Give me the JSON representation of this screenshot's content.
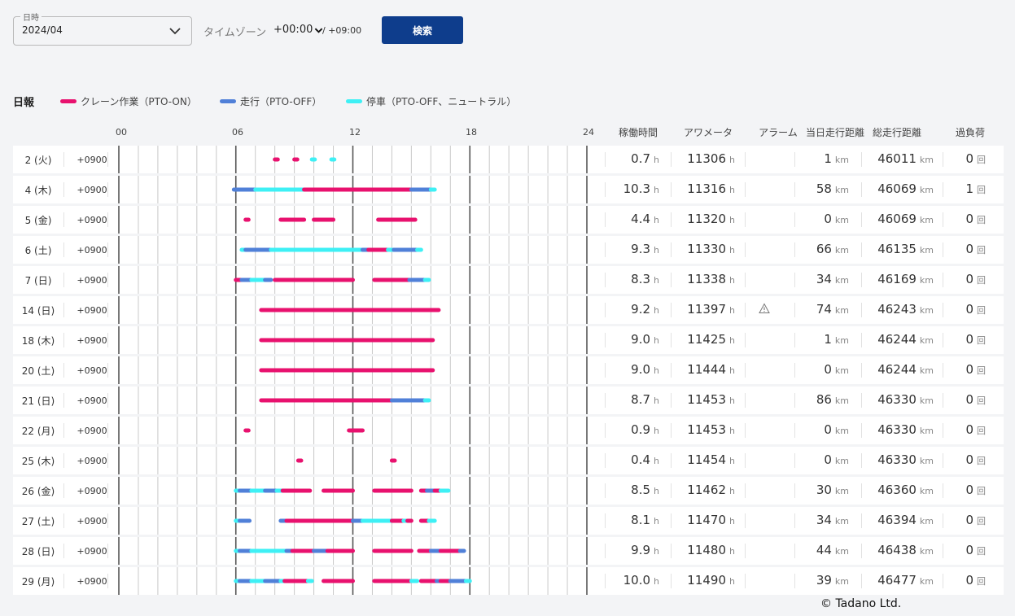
{
  "filters": {
    "date_label": "日時",
    "date_value": "2024/04",
    "timezone_label": "タイムゾーン",
    "timezone_value": "+00:00",
    "timezone_offset": "/ +09:00",
    "search_label": "検索"
  },
  "legend": {
    "title": "日報",
    "items": [
      {
        "label": "クレーン作業（PTO-ON）",
        "color": "#e8116e"
      },
      {
        "label": "走行（PTO-OFF）",
        "color": "#5080d8"
      },
      {
        "label": "停車（PTO-OFF、ニュートラル）",
        "color": "#3ef0f5"
      }
    ]
  },
  "hour_labels": [
    "00",
    "06",
    "12",
    "18",
    "24"
  ],
  "columns": {
    "operating": "稼働時間",
    "hourmeter": "アワメータ",
    "alarm": "アラーム",
    "daily_distance": "当日走行距離",
    "total_distance": "総走行距離",
    "overload": "過負荷"
  },
  "units": {
    "hours": "h",
    "km": "km",
    "count": "回"
  },
  "rows": [
    {
      "day": "2 (火)",
      "tz": "+0900",
      "operating": "0.7",
      "hourmeter": "11306",
      "alarm": false,
      "daily_km": "1",
      "total_km": "46011",
      "overload": "0",
      "segments": [
        [
          8.0,
          8.15,
          "c"
        ],
        [
          9.0,
          9.15,
          "c"
        ],
        [
          9.9,
          10.05,
          "s"
        ],
        [
          10.9,
          11.05,
          "s"
        ]
      ]
    },
    {
      "day": "4 (木)",
      "tz": "+0900",
      "operating": "10.3",
      "hourmeter": "11316",
      "alarm": false,
      "daily_km": "58",
      "total_km": "46069",
      "overload": "1",
      "segments": [
        [
          5.9,
          7.0,
          "d"
        ],
        [
          7.0,
          9.5,
          "s"
        ],
        [
          9.5,
          15.0,
          "c"
        ],
        [
          15.0,
          16.0,
          "d"
        ],
        [
          16.0,
          16.2,
          "s"
        ]
      ]
    },
    {
      "day": "5 (金)",
      "tz": "+0900",
      "operating": "4.4",
      "hourmeter": "11320",
      "alarm": false,
      "daily_km": "0",
      "total_km": "46069",
      "overload": "0",
      "segments": [
        [
          6.5,
          6.65,
          "c"
        ],
        [
          8.3,
          9.5,
          "c"
        ],
        [
          10.0,
          11.0,
          "c"
        ],
        [
          13.3,
          15.2,
          "c"
        ]
      ]
    },
    {
      "day": "6 (土)",
      "tz": "+0900",
      "operating": "9.3",
      "hourmeter": "11330",
      "alarm": false,
      "daily_km": "66",
      "total_km": "46135",
      "overload": "0",
      "segments": [
        [
          6.3,
          6.5,
          "s"
        ],
        [
          6.5,
          7.8,
          "d"
        ],
        [
          7.8,
          12.5,
          "s"
        ],
        [
          12.5,
          12.8,
          "d"
        ],
        [
          12.8,
          13.8,
          "c"
        ],
        [
          13.8,
          14.1,
          "s"
        ],
        [
          14.1,
          15.3,
          "d"
        ],
        [
          15.3,
          15.5,
          "s"
        ]
      ]
    },
    {
      "day": "7 (日)",
      "tz": "+0900",
      "operating": "8.3",
      "hourmeter": "11338",
      "alarm": false,
      "daily_km": "34",
      "total_km": "46169",
      "overload": "0",
      "segments": [
        [
          6.0,
          6.3,
          "c"
        ],
        [
          6.3,
          6.8,
          "d"
        ],
        [
          6.8,
          7.5,
          "s"
        ],
        [
          7.5,
          7.8,
          "d"
        ],
        [
          8.0,
          12.0,
          "c"
        ],
        [
          13.1,
          14.9,
          "c"
        ],
        [
          14.9,
          15.7,
          "d"
        ],
        [
          15.7,
          15.9,
          "s"
        ]
      ]
    },
    {
      "day": "14 (日)",
      "tz": "+0900",
      "operating": "9.2",
      "hourmeter": "11397",
      "alarm": true,
      "daily_km": "74",
      "total_km": "46243",
      "overload": "0",
      "segments": [
        [
          7.3,
          16.4,
          "c"
        ]
      ]
    },
    {
      "day": "18 (木)",
      "tz": "+0900",
      "operating": "9.0",
      "hourmeter": "11425",
      "alarm": false,
      "daily_km": "1",
      "total_km": "46244",
      "overload": "0",
      "segments": [
        [
          7.3,
          16.1,
          "c"
        ]
      ]
    },
    {
      "day": "20 (土)",
      "tz": "+0900",
      "operating": "9.0",
      "hourmeter": "11444",
      "alarm": false,
      "daily_km": "0",
      "total_km": "46244",
      "overload": "0",
      "segments": [
        [
          7.3,
          16.1,
          "c"
        ]
      ]
    },
    {
      "day": "21 (日)",
      "tz": "+0900",
      "operating": "8.7",
      "hourmeter": "11453",
      "alarm": false,
      "daily_km": "86",
      "total_km": "46330",
      "overload": "0",
      "segments": [
        [
          7.3,
          14.0,
          "c"
        ],
        [
          14.0,
          15.7,
          "d"
        ],
        [
          15.7,
          15.9,
          "s"
        ]
      ]
    },
    {
      "day": "22 (月)",
      "tz": "+0900",
      "operating": "0.9",
      "hourmeter": "11453",
      "alarm": false,
      "daily_km": "0",
      "total_km": "46330",
      "overload": "0",
      "segments": [
        [
          6.5,
          6.65,
          "c"
        ],
        [
          11.8,
          12.5,
          "c"
        ]
      ]
    },
    {
      "day": "25 (木)",
      "tz": "+0900",
      "operating": "0.4",
      "hourmeter": "11454",
      "alarm": false,
      "daily_km": "0",
      "total_km": "46330",
      "overload": "0",
      "segments": [
        [
          9.2,
          9.35,
          "c"
        ],
        [
          14.0,
          14.15,
          "c"
        ]
      ]
    },
    {
      "day": "26 (金)",
      "tz": "+0900",
      "operating": "8.5",
      "hourmeter": "11462",
      "alarm": false,
      "daily_km": "30",
      "total_km": "46360",
      "overload": "0",
      "segments": [
        [
          6.0,
          6.2,
          "s"
        ],
        [
          6.2,
          6.8,
          "d"
        ],
        [
          6.8,
          7.5,
          "s"
        ],
        [
          7.5,
          8.1,
          "d"
        ],
        [
          8.1,
          8.4,
          "s"
        ],
        [
          8.4,
          9.8,
          "c"
        ],
        [
          10.5,
          12.0,
          "c"
        ],
        [
          13.1,
          15.0,
          "c"
        ],
        [
          15.5,
          15.8,
          "c"
        ],
        [
          15.8,
          16.2,
          "d"
        ],
        [
          16.2,
          16.5,
          "c"
        ],
        [
          16.5,
          16.9,
          "s"
        ]
      ]
    },
    {
      "day": "27 (土)",
      "tz": "+0900",
      "operating": "8.1",
      "hourmeter": "11470",
      "alarm": false,
      "daily_km": "34",
      "total_km": "46394",
      "overload": "0",
      "segments": [
        [
          6.0,
          6.2,
          "s"
        ],
        [
          6.2,
          6.7,
          "d"
        ],
        [
          8.3,
          8.6,
          "d"
        ],
        [
          8.6,
          12.0,
          "c"
        ],
        [
          12.0,
          12.5,
          "d"
        ],
        [
          12.5,
          14.0,
          "s"
        ],
        [
          14.0,
          14.6,
          "c"
        ],
        [
          14.6,
          14.8,
          "s"
        ],
        [
          14.8,
          15.0,
          "c"
        ],
        [
          15.5,
          15.9,
          "c"
        ],
        [
          15.9,
          16.2,
          "s"
        ]
      ]
    },
    {
      "day": "28 (日)",
      "tz": "+0900",
      "operating": "9.9",
      "hourmeter": "11480",
      "alarm": false,
      "daily_km": "44",
      "total_km": "46438",
      "overload": "0",
      "segments": [
        [
          6.0,
          6.2,
          "s"
        ],
        [
          6.2,
          6.8,
          "d"
        ],
        [
          6.8,
          8.6,
          "s"
        ],
        [
          8.6,
          8.9,
          "d"
        ],
        [
          8.9,
          10.0,
          "c"
        ],
        [
          10.0,
          10.7,
          "d"
        ],
        [
          10.7,
          12.0,
          "c"
        ],
        [
          13.1,
          15.0,
          "c"
        ],
        [
          15.4,
          16.0,
          "c"
        ],
        [
          16.0,
          16.5,
          "d"
        ],
        [
          16.5,
          17.5,
          "c"
        ],
        [
          17.5,
          17.7,
          "d"
        ]
      ]
    },
    {
      "day": "29 (月)",
      "tz": "+0900",
      "operating": "10.0",
      "hourmeter": "11490",
      "alarm": false,
      "daily_km": "39",
      "total_km": "46477",
      "overload": "0",
      "segments": [
        [
          6.0,
          6.2,
          "s"
        ],
        [
          6.2,
          6.8,
          "d"
        ],
        [
          6.8,
          7.5,
          "s"
        ],
        [
          7.5,
          8.3,
          "d"
        ],
        [
          8.3,
          8.5,
          "s"
        ],
        [
          8.5,
          9.7,
          "c"
        ],
        [
          9.7,
          9.9,
          "s"
        ],
        [
          10.5,
          12.0,
          "c"
        ],
        [
          13.1,
          15.0,
          "c"
        ],
        [
          15.0,
          15.3,
          "s"
        ],
        [
          15.5,
          16.3,
          "c"
        ],
        [
          16.3,
          16.5,
          "d"
        ],
        [
          16.5,
          17.0,
          "c"
        ],
        [
          17.0,
          17.8,
          "d"
        ],
        [
          17.8,
          18.0,
          "s"
        ]
      ]
    }
  ],
  "copyright": "© Tadano Ltd."
}
